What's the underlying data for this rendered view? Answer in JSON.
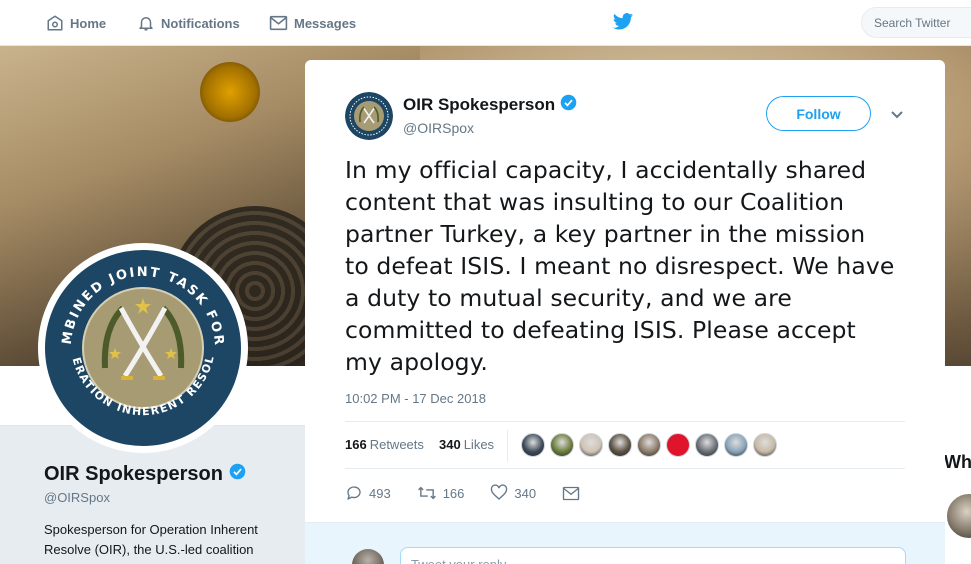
{
  "nav": {
    "home_label": "Home",
    "notifications_label": "Notifications",
    "messages_label": "Messages",
    "search_placeholder": "Search Twitter"
  },
  "profile": {
    "name": "OIR Spokesperson",
    "handle": "@OIRSpox",
    "bio": "Spokesperson for Operation Inherent Resolve (OIR), the U.S.-led coalition",
    "emblem_text_top": "COMBINED JOINT TASK FORCE",
    "emblem_text_bottom": "OPERATION INHERENT RESOLVE"
  },
  "who_to_follow": {
    "title_partial": "Wh"
  },
  "tweet": {
    "author_name": "OIR Spokesperson",
    "author_handle": "@OIRSpox",
    "follow_label": "Follow",
    "text": "In my official capacity, I accidentally shared\ncontent that was insulting to our Coalition\npartner Turkey, a key partner in the mission\nto defeat ISIS. I meant no disrespect. We have\na duty to mutual security, and we are\ncommitted to defeating ISIS. Please accept\nmy apology.",
    "timestamp": "10:02 PM - 17 Dec 2018",
    "retweets_count": "166",
    "retweets_label": "Retweets",
    "likes_count": "340",
    "likes_label": "Likes",
    "reply_count": "493",
    "retweet_action_count": "166",
    "like_action_count": "340",
    "reply_placeholder": "Tweet your reply"
  },
  "colors": {
    "accent": "#1da1f2",
    "verified": "#1da1f2",
    "text_primary": "#14171a",
    "text_secondary": "#657786",
    "liker_colors": [
      "#3d4a5a",
      "#6b7d3a",
      "#cfc3b4",
      "#5c5142",
      "#8d7a68",
      "#e0142a",
      "#6a6f75",
      "#8aa3b8",
      "#c8b9a6"
    ]
  },
  "icons": {
    "home": "home-icon",
    "notifications": "bell-icon",
    "messages": "envelope-icon",
    "brand": "twitter-bird-icon",
    "verified": "verified-badge-icon",
    "caret": "chevron-down-icon",
    "reply": "reply-icon",
    "retweet": "retweet-icon",
    "like": "heart-icon",
    "dm": "envelope-icon"
  }
}
